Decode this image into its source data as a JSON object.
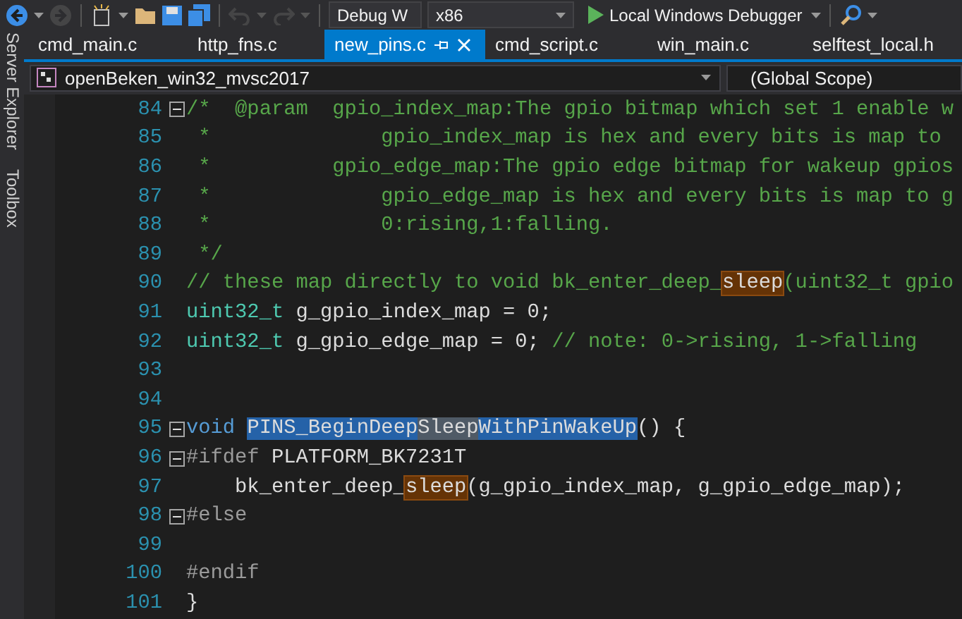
{
  "toolbar": {
    "items": [
      {
        "kind": "back",
        "disabled": false
      },
      {
        "kind": "forward",
        "disabled": true
      },
      {
        "kind": "new-item",
        "disabled": false
      },
      {
        "kind": "open-folder",
        "disabled": false
      },
      {
        "kind": "save",
        "disabled": false
      },
      {
        "kind": "save-all",
        "disabled": false
      },
      {
        "kind": "undo",
        "disabled": true
      },
      {
        "kind": "redo",
        "disabled": true
      }
    ],
    "configuration": "Debug W",
    "platform": "x86",
    "run_label": "Local Windows Debugger"
  },
  "side_tabs": [
    {
      "label": "Server Explorer"
    },
    {
      "label": "Toolbox"
    }
  ],
  "tabs": [
    {
      "label": "cmd_main.c",
      "selected": false
    },
    {
      "label": "http_fns.c",
      "selected": false
    },
    {
      "label": "new_pins.c",
      "selected": true
    },
    {
      "label": "cmd_script.c",
      "selected": false
    },
    {
      "label": "win_main.c",
      "selected": false
    },
    {
      "label": "selftest_local.h",
      "selected": false
    }
  ],
  "nav_bar": {
    "project": "openBeken_win32_mvsc2017",
    "scope": "(Global Scope)"
  },
  "editor": {
    "lines": [
      {
        "number": "84",
        "fold": {
          "expanded": true
        },
        "segments": [
          {
            "kind": "comment",
            "text": "/*  @param  gpio_index_map:The gpio bitmap which set 1 enable w"
          }
        ]
      },
      {
        "number": "85",
        "segments": [
          {
            "kind": "comment",
            "text": " *              gpio_index_map is hex and every bits is map to"
          }
        ]
      },
      {
        "number": "86",
        "segments": [
          {
            "kind": "comment",
            "text": " *          gpio_edge_map:The gpio edge bitmap for wakeup gpios"
          }
        ]
      },
      {
        "number": "87",
        "segments": [
          {
            "kind": "comment",
            "text": " *              gpio_edge_map is hex and every bits is map to g"
          }
        ]
      },
      {
        "number": "88",
        "segments": [
          {
            "kind": "comment",
            "text": " *              0:rising,1:falling."
          }
        ]
      },
      {
        "number": "89",
        "segments": [
          {
            "kind": "comment",
            "text": " */"
          }
        ]
      },
      {
        "number": "90",
        "segments": [
          {
            "kind": "comment",
            "text": "// these map directly to void bk_enter_deep_"
          },
          {
            "kind": "reference",
            "text": "sleep"
          },
          {
            "kind": "comment",
            "text": "(uint32_t gpio"
          }
        ]
      },
      {
        "number": "91",
        "segments": [
          {
            "kind": "type",
            "text": "uint32_t"
          },
          {
            "kind": "plain",
            "text": " g_gpio_index_map = 0;"
          }
        ]
      },
      {
        "number": "92",
        "segments": [
          {
            "kind": "type",
            "text": "uint32_t"
          },
          {
            "kind": "plain",
            "text": " g_gpio_edge_map = 0; "
          },
          {
            "kind": "comment",
            "text": "// note: 0->rising, 1->falling"
          }
        ]
      },
      {
        "number": "93"
      },
      {
        "number": "94"
      },
      {
        "number": "95",
        "fold": {
          "expanded": true
        },
        "segments": [
          {
            "kind": "keyword",
            "text": "void "
          },
          {
            "kind": "selection",
            "text": "PINS_BeginDeep"
          },
          {
            "kind": "selection-match",
            "text": "Sleep"
          },
          {
            "kind": "selection",
            "text": "WithPinWakeUp"
          },
          {
            "kind": "plain",
            "text": "() {"
          }
        ]
      },
      {
        "number": "96",
        "fold": {
          "expanded": true
        },
        "segments": [
          {
            "kind": "preprocessor",
            "text": "#ifdef"
          },
          {
            "kind": "plain",
            "text": " PLATFORM_BK7231T"
          }
        ]
      },
      {
        "number": "97",
        "segments": [
          {
            "kind": "plain",
            "text": "    bk_enter_deep_"
          },
          {
            "kind": "reference",
            "text": "sleep"
          },
          {
            "kind": "plain",
            "text": "(g_gpio_index_map, g_gpio_edge_map);"
          }
        ]
      },
      {
        "number": "98",
        "fold": {
          "expanded": true
        },
        "segments": [
          {
            "kind": "preprocessor",
            "text": "#else"
          }
        ]
      },
      {
        "number": "99"
      },
      {
        "number": "100",
        "segments": [
          {
            "kind": "preprocessor",
            "text": "#endif"
          }
        ]
      },
      {
        "number": "101",
        "segments": [
          {
            "kind": "plain",
            "text": "}"
          }
        ]
      }
    ]
  }
}
